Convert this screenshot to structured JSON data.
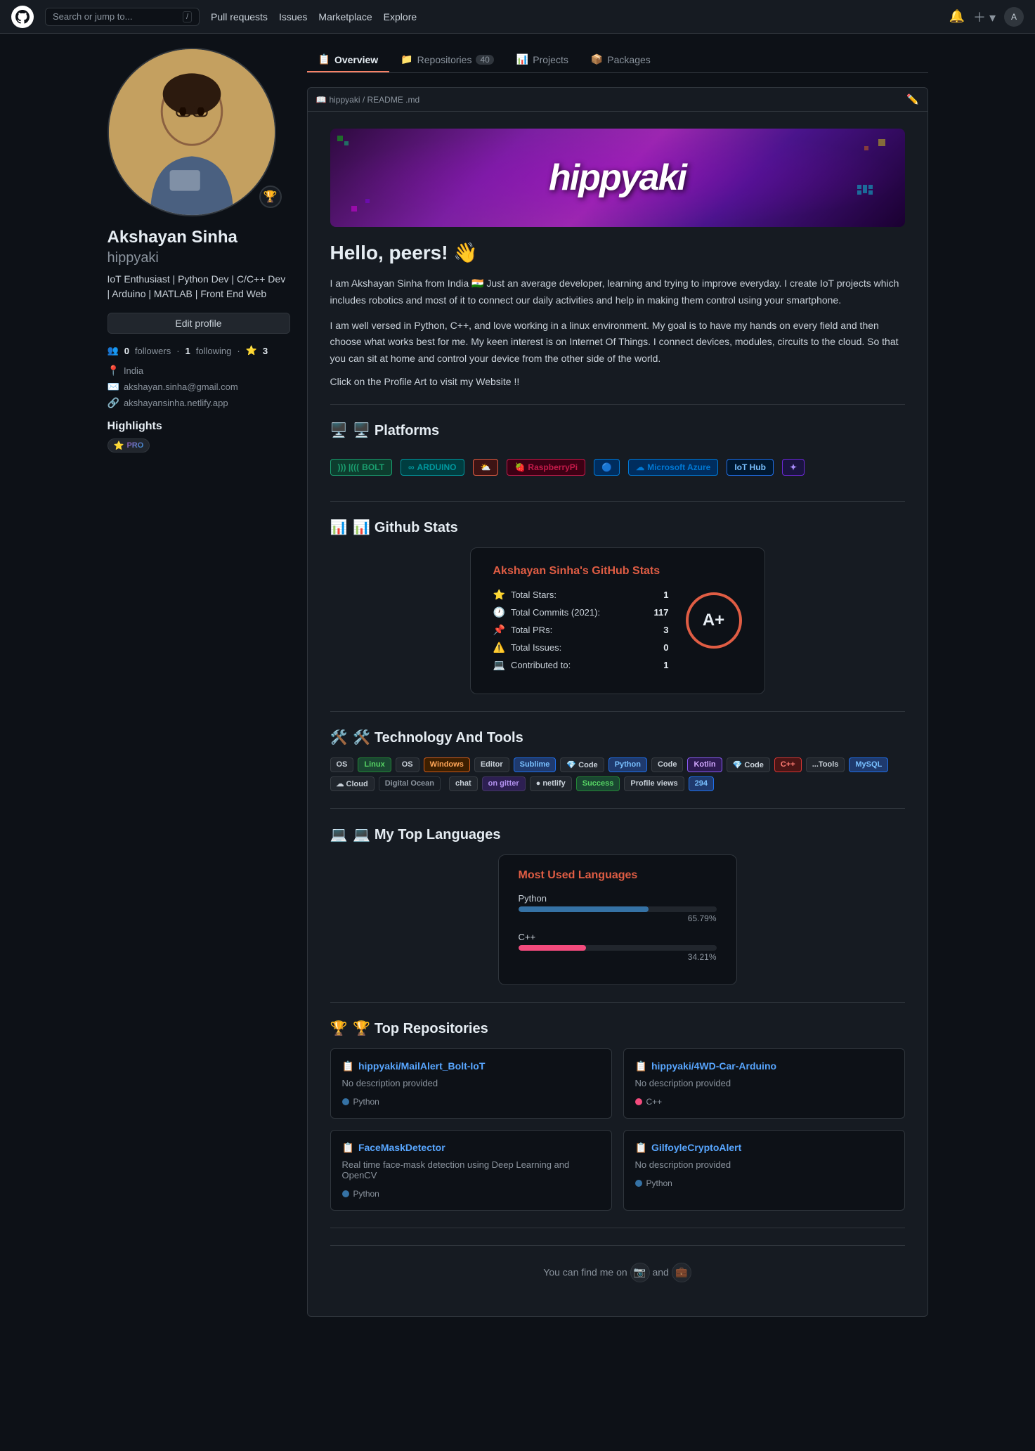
{
  "nav": {
    "logo": "🐙",
    "search_placeholder": "Search or jump to...",
    "slash_hint": "/",
    "links": [
      "Pull requests",
      "Issues",
      "Marketplace",
      "Explore"
    ],
    "bell_icon": "🔔",
    "plus_icon": "+",
    "chevron": "▾",
    "avatar_initial": "A"
  },
  "tabs": [
    {
      "label": "Overview",
      "icon": "📋",
      "active": true
    },
    {
      "label": "Repositories",
      "count": "40",
      "icon": "📁"
    },
    {
      "label": "Projects",
      "icon": "📊"
    },
    {
      "label": "Packages",
      "icon": "📦"
    }
  ],
  "profile": {
    "name": "Akshayan Sinha",
    "username": "hippyaki",
    "bio": "IoT Enthusiast | Python Dev | C/C++ Dev | Arduino | MATLAB | Front End Web",
    "edit_label": "Edit profile",
    "followers": "0",
    "following": "1",
    "stars": "3",
    "location": "India",
    "email": "akshayan.sinha@gmail.com",
    "website": "akshayansinha.netlify.app",
    "highlights_title": "Highlights",
    "star_icon": "⭐",
    "pro_label": "PRO"
  },
  "readme": {
    "breadcrumb": "hippyaki / README .md",
    "edit_icon": "✏️",
    "banner_text": "hippyaki",
    "hello_title": "Hello, peers! 👋",
    "bio_p1": "I am Akshayan Sinha from India 🇮🇳 Just an average developer, learning and trying to improve everyday. I create IoT projects which includes robotics and most of it to connect our daily activities and help in making them control using your smartphone.",
    "bio_p2": "I am well versed in Python, C++, and love working in a linux environment. My goal is to have my hands on every field and then choose what works best for me. My keen interest is on Internet Of Things. I connect devices, modules, circuits to the cloud. So that you can sit at home and control your device from the other side of the world.",
    "click_text": "Click on the Profile Art to visit my Website !!",
    "platforms_title": "🖥️ Platforms",
    "platforms": [
      {
        "name": "BOLT",
        "color": "#1a9e6f",
        "bg": "#0d3d2e"
      },
      {
        "name": "ARDUINO",
        "color": "#00979D",
        "bg": "#003d40"
      },
      {
        "name": "⛅",
        "color": "#e05d44",
        "bg": "#3d1414"
      },
      {
        "name": "RaspberryPi",
        "color": "#c51a4a",
        "bg": "#3d0014"
      },
      {
        "name": "🔵",
        "color": "#0078d4",
        "bg": "#002d5e"
      },
      {
        "name": "Microsoft Azure",
        "color": "#0078d4",
        "bg": "#002d5e"
      },
      {
        "name": "IoT Hub",
        "color": "#0078d4",
        "bg": "#002d5e"
      },
      {
        "name": "🔷",
        "color": "#0078d4",
        "bg": "#002d5e"
      }
    ],
    "github_stats_title": "📊 Github Stats",
    "stats_card_title": "Akshayan Sinha's GitHub Stats",
    "stats": [
      {
        "icon": "⭐",
        "label": "Total Stars:",
        "value": "1"
      },
      {
        "icon": "🕐",
        "label": "Total Commits (2021):",
        "value": "117"
      },
      {
        "icon": "📌",
        "label": "Total PRs:",
        "value": "3"
      },
      {
        "icon": "⚠️",
        "label": "Total Issues:",
        "value": "0"
      },
      {
        "icon": "💻",
        "label": "Contributed to:",
        "value": "1"
      }
    ],
    "grade": "A+",
    "tech_title": "🛠️ Technology And Tools",
    "tech_badges": [
      {
        "text": "OS",
        "type": "dark"
      },
      {
        "text": "Linux",
        "type": "green"
      },
      {
        "text": "OS",
        "type": "dark"
      },
      {
        "text": "Windows",
        "type": "orange"
      },
      {
        "text": "Editor",
        "type": "dark"
      },
      {
        "text": "Sublime",
        "type": "blue"
      },
      {
        "text": "Code",
        "type": "dark"
      },
      {
        "text": "Python",
        "type": "blue"
      },
      {
        "text": "Code",
        "type": "dark"
      },
      {
        "text": "Kotlin",
        "type": "purple"
      },
      {
        "text": "Code",
        "type": "dark"
      },
      {
        "text": "C++",
        "type": "red"
      },
      {
        "text": "...Tools",
        "type": "dark"
      },
      {
        "text": "MySQL",
        "type": "blue"
      },
      {
        "text": "Cloud",
        "type": "dark"
      },
      {
        "text": "Digital Ocean",
        "type": "gray"
      },
      {
        "text": "chat",
        "type": "dark"
      },
      {
        "text": "on gitter",
        "type": "gitter"
      },
      {
        "text": "● netlify",
        "type": "dark"
      },
      {
        "text": "Success",
        "type": "success"
      },
      {
        "text": "Profile views",
        "type": "dark"
      },
      {
        "text": "294",
        "type": "blue"
      }
    ],
    "languages_title": "💻 My Top Languages",
    "languages_card_title": "Most Used Languages",
    "languages": [
      {
        "name": "Python",
        "pct": "65.79%",
        "width": 65.79,
        "type": "python"
      },
      {
        "name": "C++",
        "pct": "34.21%",
        "width": 34.21,
        "type": "cpp"
      }
    ],
    "repos_title": "🏆 Top Repositories",
    "repos": [
      {
        "icon": "📋",
        "title": "hippyaki/MailAlert_Bolt-IoT",
        "desc": "No description provided",
        "lang": "Python",
        "lang_type": "python"
      },
      {
        "icon": "📋",
        "title": "hippyaki/4WD-Car-Arduino",
        "desc": "No description provided",
        "lang": "C++",
        "lang_type": "cpp"
      },
      {
        "icon": "📋",
        "title": "FaceMaskDetector",
        "desc": "Real time face-mask detection using Deep Learning and OpenCV",
        "lang": "Python",
        "lang_type": "python"
      },
      {
        "icon": "📋",
        "title": "GilfoyleCryptoAlert",
        "desc": "No description provided",
        "lang": "Python",
        "lang_type": "python"
      }
    ],
    "footer_text": "You can find me on",
    "footer_and": "and",
    "social_icons": [
      "📷",
      "💼"
    ]
  }
}
